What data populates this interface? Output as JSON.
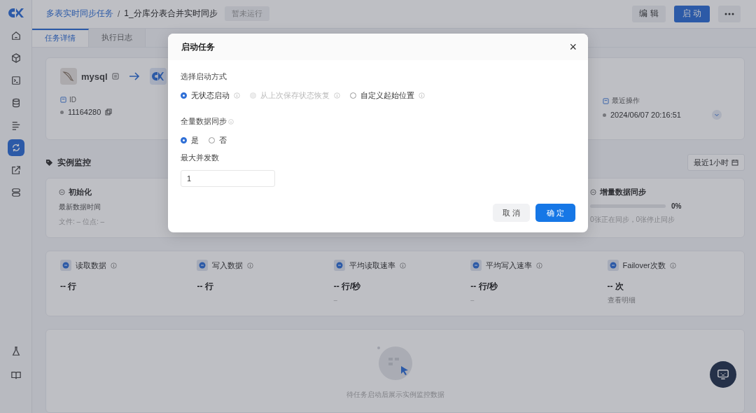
{
  "header": {
    "breadcrumb_parent": "多表实时同步任务",
    "separator": "/",
    "title": "1_分库分表合并实时同步",
    "status": "暂未运行",
    "buttons": [
      {
        "label": "编 辑",
        "kind": "plain"
      },
      {
        "label": "启 动",
        "kind": "primary"
      }
    ]
  },
  "sidebar": {
    "items": [
      {
        "selected": false
      },
      {
        "selected": false
      },
      {
        "selected": false
      },
      {
        "selected": false
      },
      {
        "selected": false
      },
      {
        "selected": true
      },
      {
        "selected": false
      },
      {
        "selected": false
      }
    ],
    "bottom_items": [
      {
        "selected": false
      },
      {
        "selected": false
      }
    ]
  },
  "tabs": [
    {
      "label": "任务详情",
      "selected": true
    },
    {
      "label": "执行日志",
      "selected": false
    }
  ],
  "connection": {
    "source": "mysql"
  },
  "fields": [
    {
      "label": "ID",
      "value": "11164280"
    },
    {
      "label": "最近操作",
      "value": "2024/06/07 20:16:51"
    }
  ],
  "monitor": {
    "title": "实例监控",
    "time_range": "最近1小时",
    "stages": [
      {
        "title": "初始化",
        "lines": [
          "最新数据时间",
          "文件:  –    位点:  –"
        ]
      },
      {
        "title": "增量数据同步",
        "level": 0,
        "percent": "0%",
        "lines": [
          "0张正在同步，0张停止同步"
        ]
      }
    ],
    "metrics": [
      {
        "label": "读取数据",
        "value": "-- 行"
      },
      {
        "label": "写入数据",
        "value": "-- 行"
      },
      {
        "label": "平均读取速率",
        "value": "-- 行/秒",
        "sub": "–"
      },
      {
        "label": "平均写入速率",
        "value": "-- 行/秒",
        "sub": "–"
      },
      {
        "label": "Failover次数",
        "value": "-- 次",
        "link": "查看明细"
      }
    ],
    "empty_text": "待任务启动后展示实例监控数据"
  },
  "dialog": {
    "title": "启动任务",
    "close": "×",
    "start_mode": {
      "label": "选择启动方式",
      "options": [
        {
          "label": "无状态启动",
          "selected": true,
          "disabled": false
        },
        {
          "label": "从上次保存状态恢复",
          "selected": false,
          "disabled": true
        },
        {
          "label": "自定义起始位置",
          "selected": false,
          "disabled": false
        }
      ]
    },
    "full_sync": {
      "label": "全量数据同步",
      "options": [
        {
          "label": "是",
          "selected": true,
          "disabled": false
        },
        {
          "label": "否",
          "selected": false,
          "disabled": false
        }
      ]
    },
    "concurrency": {
      "label": "最大并发数",
      "value": "1"
    },
    "buttons": [
      {
        "label": "取 消",
        "kind": "plain"
      },
      {
        "label": "确 定",
        "kind": "primary"
      }
    ]
  }
}
